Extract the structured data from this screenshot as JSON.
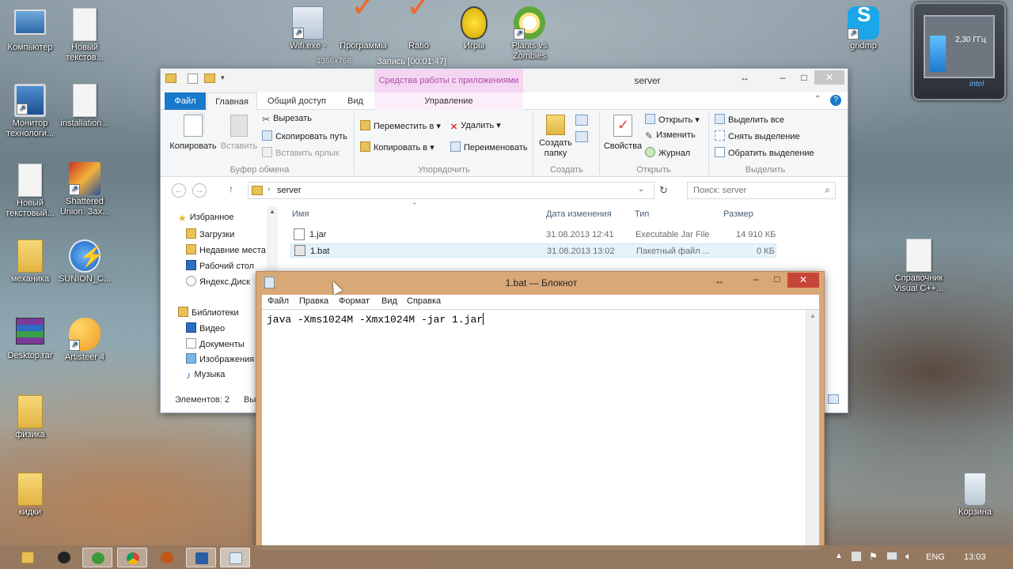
{
  "desktop": {
    "icons": [
      {
        "label": "Компьютер"
      },
      {
        "label": "Новый текстов..."
      },
      {
        "label": "Монитор технологи..."
      },
      {
        "label": "installation..."
      },
      {
        "label": "Новый текстовый..."
      },
      {
        "label": "Shattered Union. Зах..."
      },
      {
        "label": "механика"
      },
      {
        "label": "SUNION_C..."
      },
      {
        "label": "Desktop.rar"
      },
      {
        "label": "Artisteer 4"
      },
      {
        "label": "физика"
      },
      {
        "label": "кидки"
      },
      {
        "label": "Wifi.exe -"
      },
      {
        "label": "Программы"
      },
      {
        "label": "Ratio"
      },
      {
        "label": "Игры"
      },
      {
        "label": "Plants vs Zombies"
      },
      {
        "label": "gridmp"
      },
      {
        "label": "Справочник Visual C++..."
      },
      {
        "label": "Корзина"
      }
    ],
    "overlay_text": "Запись [00:01:47]",
    "overlay_text2": "1366x768",
    "gadget": {
      "freq": "2,30 ГГц",
      "brand": "intel"
    }
  },
  "explorer": {
    "title": "server",
    "context_tab_header": "Средства работы с приложениями",
    "tabs": [
      "Файл",
      "Главная",
      "Общий доступ",
      "Вид",
      "Управление"
    ],
    "ribbon": {
      "clipboard": {
        "label": "Буфер обмена",
        "copy": "Копировать",
        "paste": "Вставить",
        "cut": "Вырезать",
        "copy_path": "Скопировать путь",
        "paste_shortcut": "Вставить ярлык"
      },
      "organize": {
        "label": "Упорядочить",
        "move_to": "Переместить в",
        "copy_to": "Копировать в",
        "delete": "Удалить",
        "rename": "Переименовать"
      },
      "create": {
        "label": "Создать",
        "new_folder_1": "Создать",
        "new_folder_2": "папку"
      },
      "open": {
        "label": "Открыть",
        "properties": "Свойства",
        "open": "Открыть",
        "edit": "Изменить",
        "history": "Журнал"
      },
      "select": {
        "label": "Выделить",
        "select_all": "Выделить все",
        "select_none": "Снять выделение",
        "invert": "Обратить выделение"
      }
    },
    "address": "server",
    "search_placeholder": "Поиск: server",
    "nav": {
      "favorites": "Избранное",
      "downloads": "Загрузки",
      "recent": "Недавние места",
      "desktop": "Рабочий стол",
      "yadisk": "Яндекс.Диск",
      "libraries": "Библиотеки",
      "video": "Видео",
      "documents": "Документы",
      "images": "Изображения",
      "music": "Музыка"
    },
    "columns": {
      "name": "Имя",
      "date": "Дата изменения",
      "type": "Тип",
      "size": "Размер"
    },
    "files": [
      {
        "name": "1.jar",
        "date": "31.08.2013 12:41",
        "type": "Executable Jar File",
        "size": "14 910 КБ"
      },
      {
        "name": "1.bat",
        "date": "31.08.2013 13:02",
        "type": "Пакетный файл ...",
        "size": "0 КБ"
      }
    ],
    "status": "Элементов: 2",
    "status_tail": "Вы"
  },
  "notepad": {
    "title": "1.bat — Блокнот",
    "menu": [
      "Файл",
      "Правка",
      "Формат",
      "Вид",
      "Справка"
    ],
    "content": "java -Xms1024M -Xmx1024M -jar 1.jar"
  },
  "taskbar": {
    "lang": "ENG",
    "time": "13:03"
  }
}
